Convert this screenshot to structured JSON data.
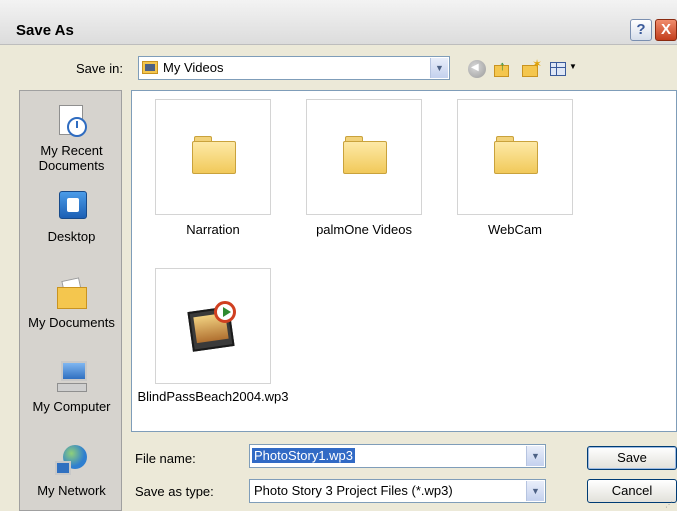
{
  "window": {
    "title": "Save As",
    "help_glyph": "?",
    "close_glyph": "X"
  },
  "toolbar": {
    "save_in_label": "Save in:",
    "save_in_value": "My Videos",
    "icons": [
      "back-icon",
      "up-folder-icon",
      "new-folder-icon",
      "views-menu-icon"
    ]
  },
  "places": [
    {
      "label": "My Recent Documents",
      "line1": "My Recent",
      "line2": "Documents",
      "icon": "recent-documents-icon"
    },
    {
      "label": "Desktop",
      "line1": "Desktop",
      "line2": "",
      "icon": "desktop-icon"
    },
    {
      "label": "My Documents",
      "line1": "My Documents",
      "line2": "",
      "icon": "my-documents-icon"
    },
    {
      "label": "My Computer",
      "line1": "My Computer",
      "line2": "",
      "icon": "my-computer-icon"
    },
    {
      "label": "My Network",
      "line1": "My Network",
      "line2": "",
      "icon": "network-icon"
    }
  ],
  "files": [
    {
      "name": "Narration",
      "type": "folder"
    },
    {
      "name": "palmOne Videos",
      "type": "folder"
    },
    {
      "name": "WebCam",
      "type": "folder"
    },
    {
      "name": "BlindPassBeach2004.wp3",
      "type": "photostory-project"
    }
  ],
  "form": {
    "file_name_label": "File name:",
    "file_name_value": "PhotoStory1.wp3",
    "save_as_type_label": "Save as type:",
    "save_as_type_value": "Photo Story 3 Project Files (*.wp3)"
  },
  "buttons": {
    "save": "Save",
    "cancel": "Cancel"
  },
  "colors": {
    "dialog_bg": "#ece9d8",
    "selection": "#316ac5",
    "folder": "#f4c64e"
  }
}
